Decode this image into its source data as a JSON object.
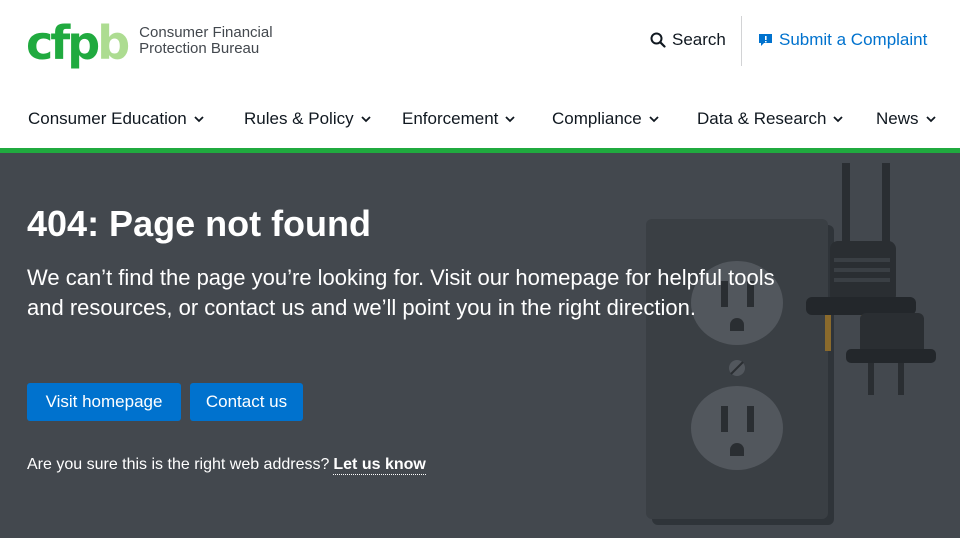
{
  "header": {
    "logo_letters": [
      "c",
      "f",
      "p",
      "b"
    ],
    "logo_line1": "Consumer Financial",
    "logo_line2": "Protection Bureau",
    "search_label": "Search",
    "complaint_label": "Submit a Complaint",
    "icons": {
      "search": "search-icon",
      "complaint": "speech-bubble-icon"
    }
  },
  "nav": {
    "items": [
      {
        "label": "Consumer Education"
      },
      {
        "label": "Rules & Policy"
      },
      {
        "label": "Enforcement"
      },
      {
        "label": "Compliance"
      },
      {
        "label": "Data & Research"
      },
      {
        "label": "News"
      }
    ]
  },
  "hero": {
    "title": "404: Page not found",
    "body": "We can’t find the page you’re looking for. Visit our homepage for helpful tools and resources, or contact us and we’ll point you in the right direction.",
    "primary_button": "Visit homepage",
    "secondary_button": "Contact us",
    "footer_question": "Are you sure this is the right web address?",
    "footer_link": "Let us know",
    "illustration": "unplugged-outlet-illustration"
  },
  "colors": {
    "brand_green": "#20aa3f",
    "light_green": "#addc91",
    "link_blue": "#0072ce",
    "hero_bg": "#43484e"
  }
}
